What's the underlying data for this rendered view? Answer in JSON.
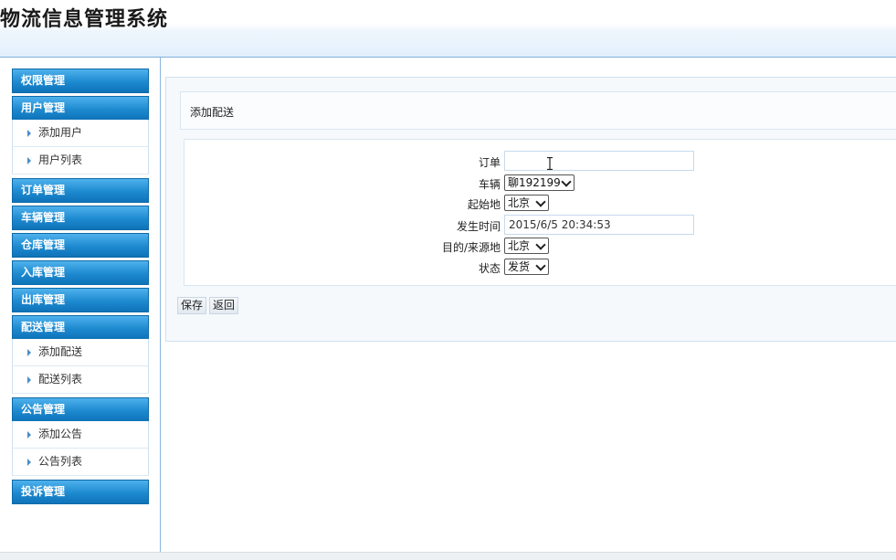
{
  "app": {
    "title": "物流信息管理系统"
  },
  "sidebar": {
    "groups": [
      {
        "label": "权限管理",
        "items": []
      },
      {
        "label": "用户管理",
        "items": [
          "添加用户",
          "用户列表"
        ]
      },
      {
        "label": "订单管理",
        "items": []
      },
      {
        "label": "车辆管理",
        "items": []
      },
      {
        "label": "仓库管理",
        "items": []
      },
      {
        "label": "入库管理",
        "items": []
      },
      {
        "label": "出库管理",
        "items": []
      },
      {
        "label": "配送管理",
        "items": [
          "添加配送",
          "配送列表"
        ]
      },
      {
        "label": "公告管理",
        "items": [
          "添加公告",
          "公告列表"
        ]
      },
      {
        "label": "投诉管理",
        "items": []
      }
    ]
  },
  "page": {
    "heading": "添加配送"
  },
  "form": {
    "order": {
      "label": "订单",
      "value": ""
    },
    "vehicle": {
      "label": "车辆",
      "selected": "聊192199"
    },
    "origin": {
      "label": "起始地",
      "selected": "北京"
    },
    "time": {
      "label": "发生时间",
      "value": "2015/6/5 20:34:53"
    },
    "destination": {
      "label": "目的/来源地",
      "selected": "北京"
    },
    "status": {
      "label": "状态",
      "selected": "发货"
    }
  },
  "actions": {
    "save": "保存",
    "back": "返回"
  },
  "colors": {
    "menu_head": "#1d8ad0",
    "header_bg": "#e2f0fb",
    "border": "#8ab6dc"
  }
}
